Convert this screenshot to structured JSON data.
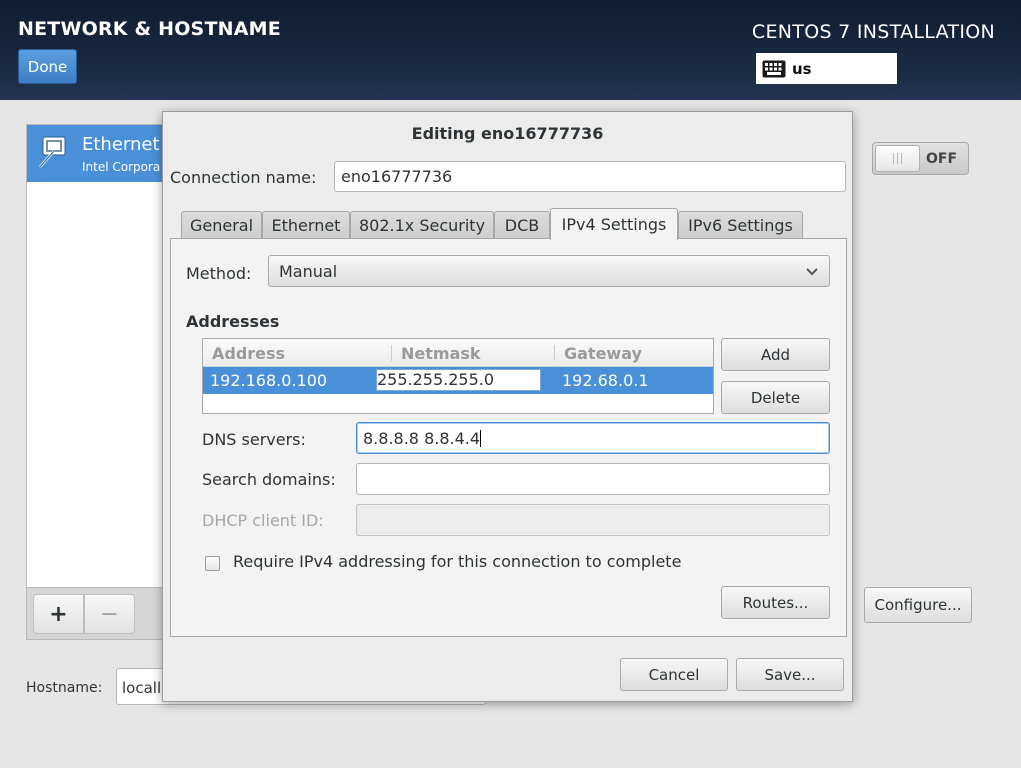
{
  "header": {
    "page_title": "NETWORK & HOSTNAME",
    "done_label": "Done",
    "product_title": "CENTOS 7 INSTALLATION",
    "keyboard_layout": "us"
  },
  "device_list": {
    "items": [
      {
        "name": "Ethernet",
        "subtitle": "Intel Corpora",
        "icon": "ethernet-icon"
      }
    ],
    "add_label": "+",
    "remove_label": "−"
  },
  "toggle": {
    "state": "OFF"
  },
  "configure_label": "Configure...",
  "hostname": {
    "label": "Hostname:",
    "value": "locall"
  },
  "dialog": {
    "title": "Editing eno16777736",
    "connection_name_label": "Connection name:",
    "connection_name_value": "eno16777736",
    "tabs": [
      {
        "label": "General"
      },
      {
        "label": "Ethernet"
      },
      {
        "label": "802.1x Security"
      },
      {
        "label": "DCB"
      },
      {
        "label": "IPv4 Settings",
        "active": true
      },
      {
        "label": "IPv6 Settings"
      }
    ],
    "method_label": "Method:",
    "method_value": "Manual",
    "addresses_title": "Addresses",
    "address_columns": [
      "Address",
      "Netmask",
      "Gateway"
    ],
    "address_rows": [
      {
        "address": "192.168.0.100",
        "netmask": "255.255.255.0",
        "gateway": "192.68.0.1"
      }
    ],
    "add_label": "Add",
    "delete_label": "Delete",
    "dns_label": "DNS servers:",
    "dns_value": "8.8.8.8 8.8.4.4",
    "search_domains_label": "Search domains:",
    "search_domains_value": "",
    "dhcp_client_id_label": "DHCP client ID:",
    "dhcp_client_id_value": "",
    "require_ipv4_label": "Require IPv4 addressing for this connection to complete",
    "require_ipv4_checked": false,
    "routes_label": "Routes...",
    "cancel_label": "Cancel",
    "save_label": "Save..."
  },
  "colors": {
    "header_bg": "#1a2b44",
    "accent_blue": "#4a90d9",
    "done_button": "#3d7fc6"
  }
}
